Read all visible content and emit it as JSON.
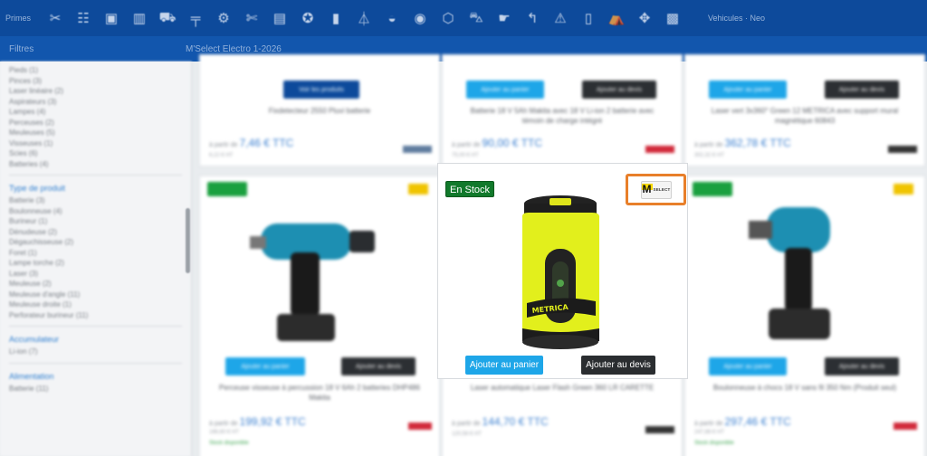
{
  "topbar": {
    "brand_label": "Primes",
    "more_label": "Vehicules · Neo",
    "icons": [
      "wrench-icon",
      "ladder-icon",
      "box-icon",
      "shelf-icon",
      "cart-icon",
      "pipe-icon",
      "gear-icon",
      "scissors-icon",
      "chart-icon",
      "bolt-icon",
      "bottle-icon",
      "saw-icon",
      "helmet-icon",
      "clock-icon",
      "bucket-icon",
      "truck-icon",
      "drill-icon",
      "arrow-icon",
      "warning-icon",
      "door-icon",
      "tent-icon",
      "drone-icon",
      "hanger-icon"
    ]
  },
  "subbar": {
    "left_label": "Filtres",
    "center_label": "M'Select Electro 1-2026"
  },
  "sidebar": {
    "top_lines": [
      "Pieds (1)",
      "Pinces (3)",
      "Laser linéaire (2)",
      "Aspirateurs (3)",
      "Lampes (4)",
      "Perceuses (2)",
      "Meuleuses (5)",
      "Visseuses (1)",
      "Scies (6)",
      "Batteries (4)"
    ],
    "type_heading": "Type de produit",
    "type_lines": [
      "Batterie (3)",
      "Boulonneuse (4)",
      "Burineur (1)",
      "Dénudeuse (2)",
      "Dégauchisseuse (2)",
      "Foret (1)",
      "Lampe torche (2)",
      "Laser (3)",
      "Meuleuse (2)",
      "Meuleuse d'angle (11)",
      "Meuleuse droite (1)",
      "Perforateur burineur (11)"
    ],
    "accu_heading": "Accumulateur",
    "accu_lines": [
      "Li-ion (7)"
    ],
    "alim_heading": "Alimentation",
    "alim_lines": [
      "Batterie (11)"
    ]
  },
  "focus_card": {
    "stock_label": "En Stock",
    "cart_label": "Ajouter au panier",
    "quote_label": "Ajouter au devis",
    "brand_logo_text": "M",
    "brand_logo_sub": "SELECT",
    "product_print": "METRICA"
  },
  "cards": [
    {
      "title": "Fixdetecteur 2550 Pluvi batterie",
      "price_prefix": "à partir de",
      "price": "7,46 € TTC",
      "sub": "6,22 € HT",
      "btn": "Voir les produits"
    },
    {
      "title": "Batterie 18 V 5Ah Makita avec 18 V Li-ion 2 batterie avec témoin de charge intégré",
      "price_prefix": "à partir de",
      "price": "90,00 € TTC",
      "sub": "75,00 € HT",
      "btn": "Ajouter au panier",
      "btn2": "Ajouter au devis"
    },
    {
      "title": "Laser vert 3x360° Green 12 METRICA avec support mural magnétique 60843",
      "price_prefix": "à partir de",
      "price": "362,78 € TTC",
      "sub": "302,32 € HT",
      "btn": "Ajouter au panier",
      "btn2": "Ajouter au devis"
    },
    {
      "title": "Perceuse visseuse à percussion 18 V 6Ah 2 batteries DHP486 Makita",
      "price_prefix": "à partir de",
      "price": "199,92 € TTC",
      "sub": "166,60 € HT",
      "btn": "Ajouter au panier",
      "btn2": "Ajouter au devis",
      "check": "Stock disponible"
    },
    {
      "title": "Laser automatique Laser Flash Green 360 LR CARETTE",
      "price_prefix": "à partir de",
      "price": "144,70 € TTC",
      "sub": "120,58 € HT"
    },
    {
      "title": "Boulonneuse à chocs 18 V sans fil 350 Nm (Produit seul)",
      "price_prefix": "à partir de",
      "price": "297,46 € TTC",
      "sub": "247,88 € HT",
      "btn": "Ajouter au panier",
      "btn2": "Ajouter au devis",
      "check": "Stock disponible"
    }
  ],
  "colors": {
    "toolbar": "#0d4a9b",
    "accent_blue": "#1ea6e8",
    "stock_green": "#11792b",
    "highlight_orange": "#e87f2a",
    "dark_button": "#2a2d30",
    "laser_yellow": "#e2ef1c"
  }
}
